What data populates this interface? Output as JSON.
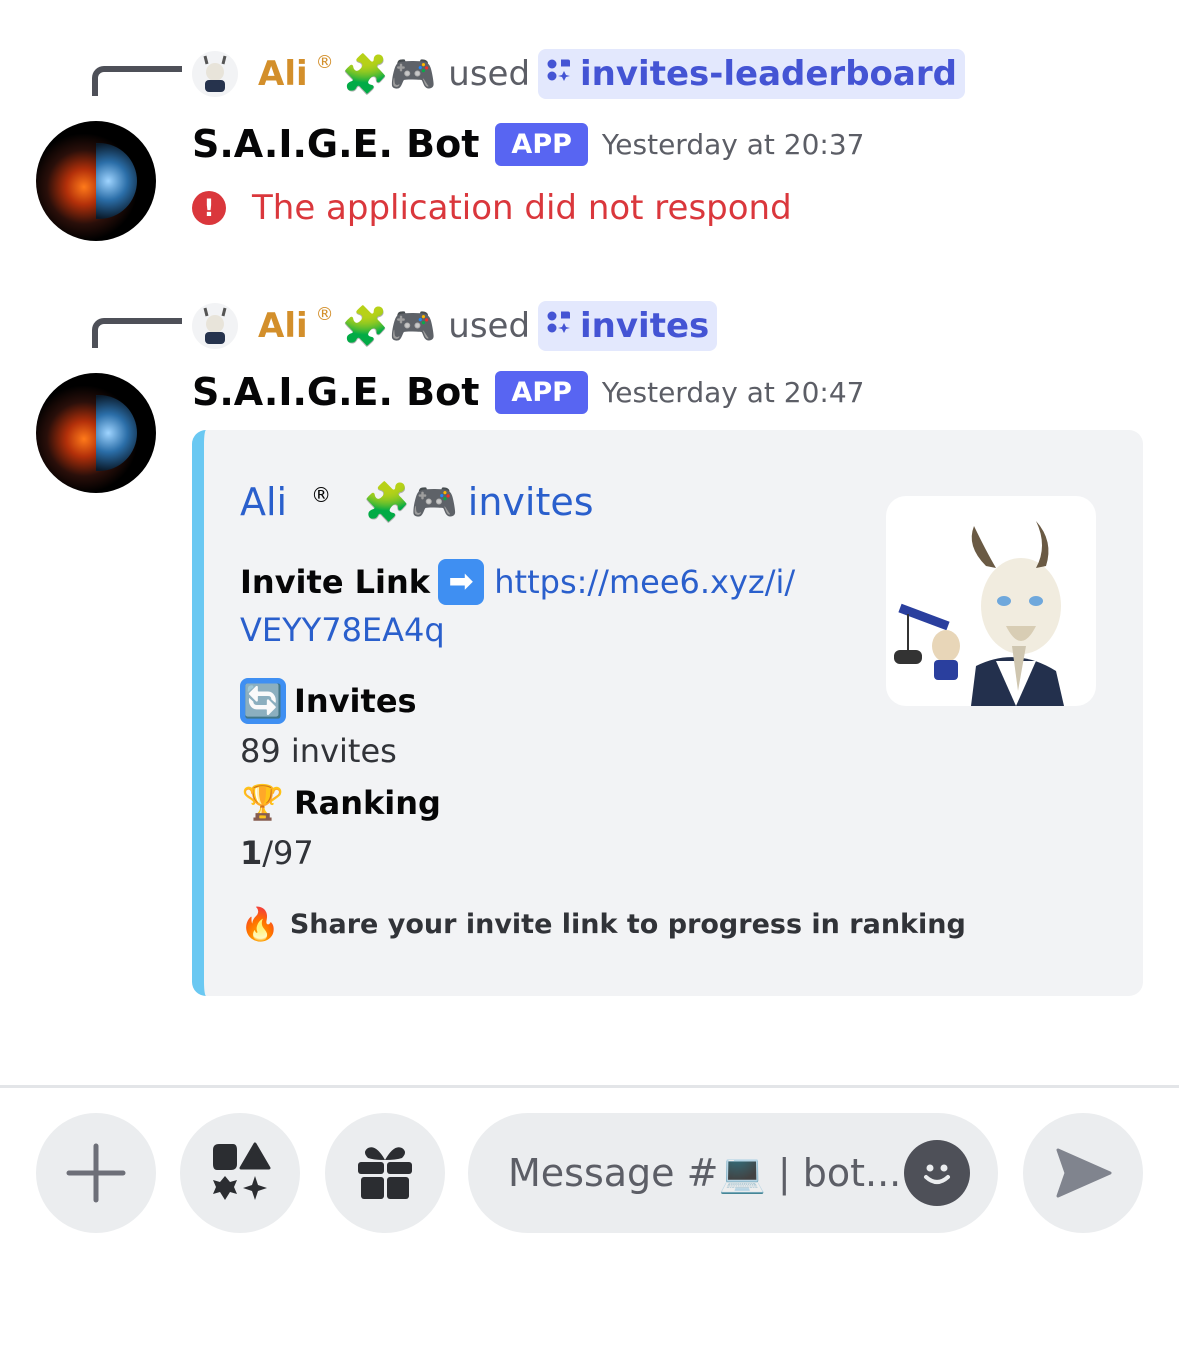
{
  "messages": [
    {
      "context": {
        "user_name": "Ali",
        "user_mark": "®",
        "badge_emojis": "🧩🎮",
        "verb": "used",
        "command": "invites-leaderboard"
      },
      "author": "S.A.I.G.E. Bot",
      "badge": "APP",
      "timestamp": "Yesterday at 20:37",
      "error_text": "The application did not respond",
      "error_icon": "alert-circle"
    },
    {
      "context": {
        "user_name": "Ali",
        "user_mark": "®",
        "badge_emojis": "🧩🎮",
        "verb": "used",
        "command": "invites"
      },
      "author": "S.A.I.G.E. Bot",
      "badge": "APP",
      "timestamp": "Yesterday at 20:47",
      "embed": {
        "accent_color": "#6ac8f2",
        "author_name": "Ali",
        "author_mark": "®",
        "author_emojis": "🧩🎮",
        "title": "invites",
        "invite_link_label": "Invite Link",
        "invite_link_emoji": "➡",
        "invite_link_url_line1": "https://mee6.xyz/i/",
        "invite_link_url_line2": "VEYY78EA4q",
        "invites_emoji": "🔄",
        "invites_label": "Invites",
        "invites_value": "89 invites",
        "ranking_emoji": "🏆",
        "ranking_label": "Ranking",
        "ranking_position": "1",
        "ranking_total": "/97",
        "footer_emoji": "🔥",
        "footer_text": "Share your invite link to progress in ranking",
        "thumbnail": "goat-avatar"
      }
    }
  ],
  "composer": {
    "placeholder": "Message #💻 | bot...",
    "buttons": [
      "plus-icon",
      "apps-icon",
      "gift-icon",
      "emoji-icon",
      "send-icon"
    ]
  }
}
